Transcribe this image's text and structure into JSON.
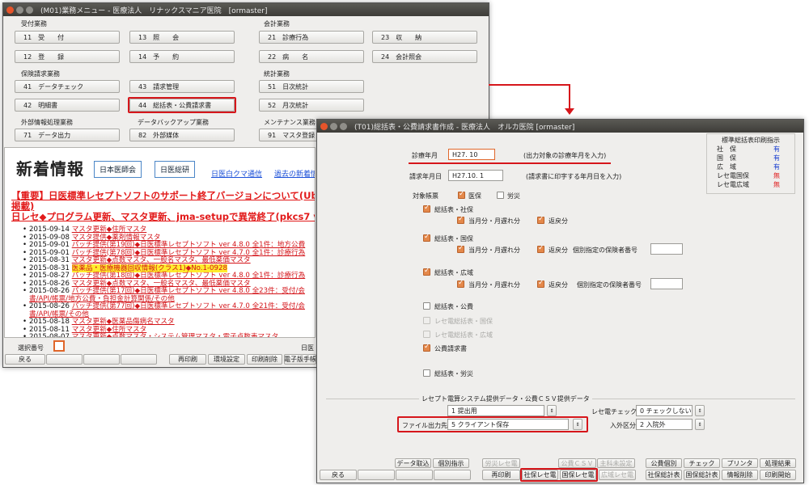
{
  "main_window": {
    "title": "(M01)業務メニュー - 医療法人　リナックスマニア医院　[ormaster]",
    "groups": {
      "uketsuke": "受付業務",
      "kaikei": "会計業務",
      "hoken": "保険請求業務",
      "toukei": "統計業務",
      "gaibu": "外部情報処理業務",
      "backup": "データバックアップ業務",
      "maint": "メンテナンス業務"
    },
    "menu": {
      "b11": "11　受　　付",
      "b13": "13　照　　会",
      "b21": "21　診療行為",
      "b23": "23　収　　納",
      "b12": "12　登　　録",
      "b14": "14　予　　約",
      "b22": "22　病　　名",
      "b24": "24　会計照会",
      "b41": "41　データチェック",
      "b43": "43　請求管理",
      "b51": "51　日次統計",
      "b42": "42　明細書",
      "b44": "44　総括表・公費請求書",
      "b52": "52　月次統計",
      "b71": "71　データ出力",
      "b82": "82　外部媒体",
      "b91": "91　マスタ登録"
    },
    "news": {
      "title": "新着情報",
      "jma_button": "日本医師会",
      "souken_button": "日医総研",
      "link1": "日医白クマ通信",
      "link2": "過去の新着情",
      "important1": "【重要】日医標準レセプトソフトのサポート終了バージョンについて(Ubuntu1",
      "important1b": "掲載)",
      "important2": "日レセ◆プログラム更新、マスタ更新、jma-setupで異常終了(pkcs7 verify",
      "items": [
        {
          "date": "2015-09-14",
          "text": "マスタ更新◆住所マスタ",
          "hl": false
        },
        {
          "date": "2015-09-08",
          "text": "マスタ提供◆薬剤情報マスタ",
          "hl": false
        },
        {
          "date": "2015-09-01",
          "text": "パッチ提供(第19回)◆日医標準レセプトソフト ver 4.8.0 全1件：地方公費",
          "hl": false
        },
        {
          "date": "2015-09-01",
          "text": "パッチ提供(第78回)◆日医標準レセプトソフト ver 4.7.0 全1件：診療行為",
          "hl": false
        },
        {
          "date": "2015-08-31",
          "text": "マスタ更新◆点数マスタ、一般名マスタ、最低薬価マスタ",
          "hl": false
        },
        {
          "date": "2015-08-31",
          "text": "医薬品・医療機器回収情報(クラス1)◆No.1-0928",
          "hl": true
        },
        {
          "date": "2015-08-27",
          "text": "パッチ提供(第18回)◆日医標準レセプトソフト ver 4.8.0 全1件：診療行為",
          "hl": false
        },
        {
          "date": "2015-08-26",
          "text": "マスタ更新◆点数マスタ、一般名マスタ、最低薬価マスタ",
          "hl": false
        },
        {
          "date": "2015-08-26",
          "text": "パッチ提供(第17回)◆日医標準レセプトソフト ver 4.8.0 全23件：受付/会",
          "hl": false
        },
        {
          "date": "",
          "text": "書/API/帳票/地方公費・負担金計算関係/その他",
          "hl": false
        },
        {
          "date": "2015-08-26",
          "text": "パッチ提供(第77回)◆日医標準レセプトソフト ver 4.7.0 全21件：受付/会",
          "hl": false
        },
        {
          "date": "",
          "text": "書/API/帳票/その他",
          "hl": false
        },
        {
          "date": "2015-08-18",
          "text": "マスタ更新◆医薬品傷病名マスタ",
          "hl": false
        },
        {
          "date": "2015-08-11",
          "text": "マスタ更新◆住所マスタ",
          "hl": false
        },
        {
          "date": "2015-08-07",
          "text": "マスタ更新◆点数マスタ・システム管理マスタ・電子点数表マスタ",
          "hl": false
        }
      ]
    },
    "select_label": "選択番号",
    "nichii_label": "日医",
    "bottom": {
      "back": "戻る",
      "reprint": "再印刷",
      "env": "環境設定",
      "printdel": "印刷削除",
      "denshi": "電子版手帳"
    }
  },
  "sub_window": {
    "title": "(T01)総括表・公費請求書作成 - 医療法人　オルカ医院 [ormaster]",
    "shinryo_label": "診療年月",
    "shinryo_value": "H27. 10",
    "shinryo_hint": "(出力対象の診療年月を入力)",
    "seikyu_label": "請求年月日",
    "seikyu_value": "H27.10. 1",
    "seikyu_hint": "(請求書に印字する年月日を入力)",
    "taisho_label": "対象帳票",
    "iho": "医保",
    "rousai": "労災",
    "shaho_title": "総括表・社保",
    "toutsuki": "当月分・月遅れ分",
    "henrei": "返戻分",
    "kokuho_title": "総括表・国保",
    "kobetsu": "個別指定の保険者番号",
    "kouiki_title": "総括表・広域",
    "kouhi_title": "総括表・公費",
    "rece_kokuho": "レセ電総括表・国保",
    "rece_kouiki": "レセ電総括表・広域",
    "kouhi_seikyu": "公費請求書",
    "rousai_title": "総括表・労災",
    "csv_group": "レセプト電算システム提供データ・公費ＣＳＶ提供データ",
    "teikyo_value": "1 提出用",
    "file_label": "ファイル出力先",
    "file_value": "5 クライアント保存",
    "recheck_label": "レセ電チェック",
    "recheck_value": "0 チェックしない",
    "nyugai_label": "入外区分",
    "nyugai_value": "2 入院外",
    "panel_title": "標準総括表印刷指示",
    "panel_rows": [
      {
        "label": "社　保",
        "value": "有",
        "color": "#1a3fd0"
      },
      {
        "label": "国　保",
        "value": "有",
        "color": "#1a3fd0"
      },
      {
        "label": "広　域",
        "value": "有",
        "color": "#1a3fd0"
      },
      {
        "label": "レセ電国保",
        "value": "無",
        "color": "#e01f1f"
      },
      {
        "label": "レセ電広域",
        "value": "無",
        "color": "#e01f1f"
      }
    ],
    "buttons": {
      "data_torikomi": "データ取込",
      "kobetsu_shiji": "個別指示",
      "kyodo_rece": "労災レセ電",
      "kouhi_csv": "公費ＣＳＶ",
      "shukai": "主科未設定",
      "kouhi_kobetsu": "公費個別",
      "check": "チェック",
      "printer": "プリンタ",
      "shori_kekka": "処理結果",
      "back": "戻る",
      "reprint": "再印刷",
      "shaho_rece": "社保レセ電",
      "kokuho_rece": "国保レセ電",
      "kouiki_rece": "広域レセ電",
      "shaho_soukatsu": "社保総計表",
      "kokuho_soukatsu": "国保総計表",
      "info_del": "情報削除",
      "print_start": "印刷開始"
    }
  }
}
